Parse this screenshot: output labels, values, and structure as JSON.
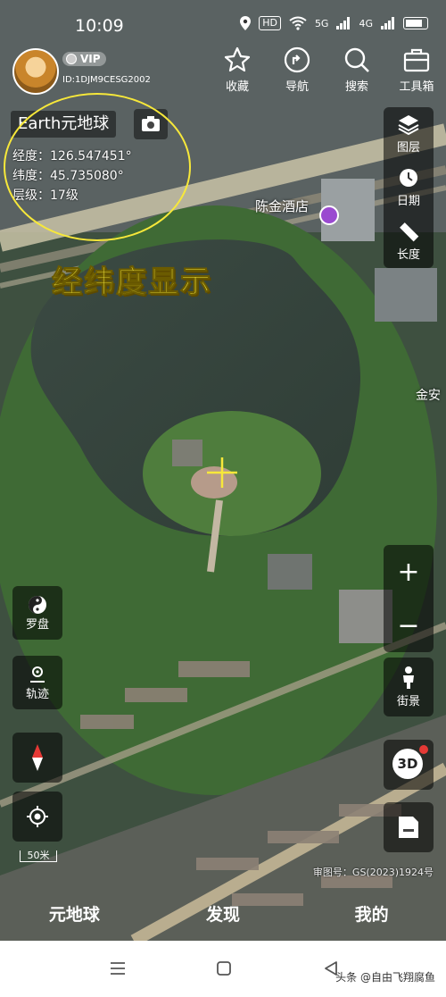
{
  "status_bar": {
    "time": "10:09",
    "hd": "HD",
    "network1": "5G",
    "network2": "4G"
  },
  "user": {
    "vip_label": "VIP",
    "id": "ID:1DJM9CESG2002"
  },
  "top_tools": [
    {
      "label": "收藏",
      "icon": "star-icon"
    },
    {
      "label": "导航",
      "icon": "navigation-icon"
    },
    {
      "label": "搜索",
      "icon": "search-icon"
    },
    {
      "label": "工具箱",
      "icon": "toolbox-icon"
    }
  ],
  "info": {
    "title": "Earth元地球",
    "lon_label": "经度：",
    "lon_value": "126.547451°",
    "lat_label": "纬度：",
    "lat_value": "45.735080°",
    "level_label": "层级：",
    "level_value": "17级"
  },
  "caption": "经纬度显示",
  "map_labels": {
    "poi": "陈金酒店",
    "poi2": "金安"
  },
  "right_tools_top": [
    {
      "label": "图层",
      "icon": "layers-icon"
    },
    {
      "label": "日期",
      "icon": "date-icon"
    },
    {
      "label": "长度",
      "icon": "ruler-icon"
    }
  ],
  "zoom": {
    "in": "+",
    "out": "−"
  },
  "right_tools_bottom": [
    {
      "label": "街景",
      "icon": "streetview-icon"
    },
    {
      "label": "3D",
      "icon": "3d-icon"
    }
  ],
  "left_tools": [
    {
      "label": "罗盘",
      "icon": "compass-icon"
    },
    {
      "label": "轨迹",
      "icon": "track-icon"
    }
  ],
  "scale": "50米",
  "approval_number": "审图号：GS(2023)1924号",
  "tabs": [
    "元地球",
    "发现",
    "我的"
  ],
  "watermark": "头条 @自由飞翔腐鱼",
  "colors": {
    "highlight": "#f7e83a",
    "panel_bg": "rgba(0,0,0,0.55)",
    "badge_red": "#e53935"
  }
}
